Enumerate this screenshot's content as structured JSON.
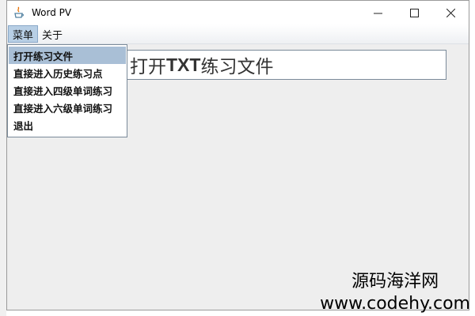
{
  "window": {
    "title": "Word PV",
    "controls": {
      "minimize": "—",
      "maximize": "☐",
      "close": "✕"
    }
  },
  "menubar": {
    "items": [
      {
        "label": "菜单",
        "active": true
      },
      {
        "label": "关于",
        "active": false
      }
    ]
  },
  "dropdown": {
    "items": [
      {
        "label": "打开练习文件",
        "selected": true
      },
      {
        "label": "直接进入历史练习点",
        "selected": false
      },
      {
        "label": "直接进入四级单词练习",
        "selected": false
      },
      {
        "label": "直接进入六级单词练习",
        "selected": false
      },
      {
        "label": "退出",
        "selected": false
      }
    ]
  },
  "text_box": {
    "prefix": "打开",
    "bold": "TXT",
    "suffix": "练习文件"
  },
  "watermark": {
    "title": "源码海洋网",
    "url": "www.codehy.com"
  },
  "colors": {
    "menu_active": "#b8cfe5",
    "dropdown_selected": "#a9bfd6",
    "window_bg": "#eeeeee"
  }
}
